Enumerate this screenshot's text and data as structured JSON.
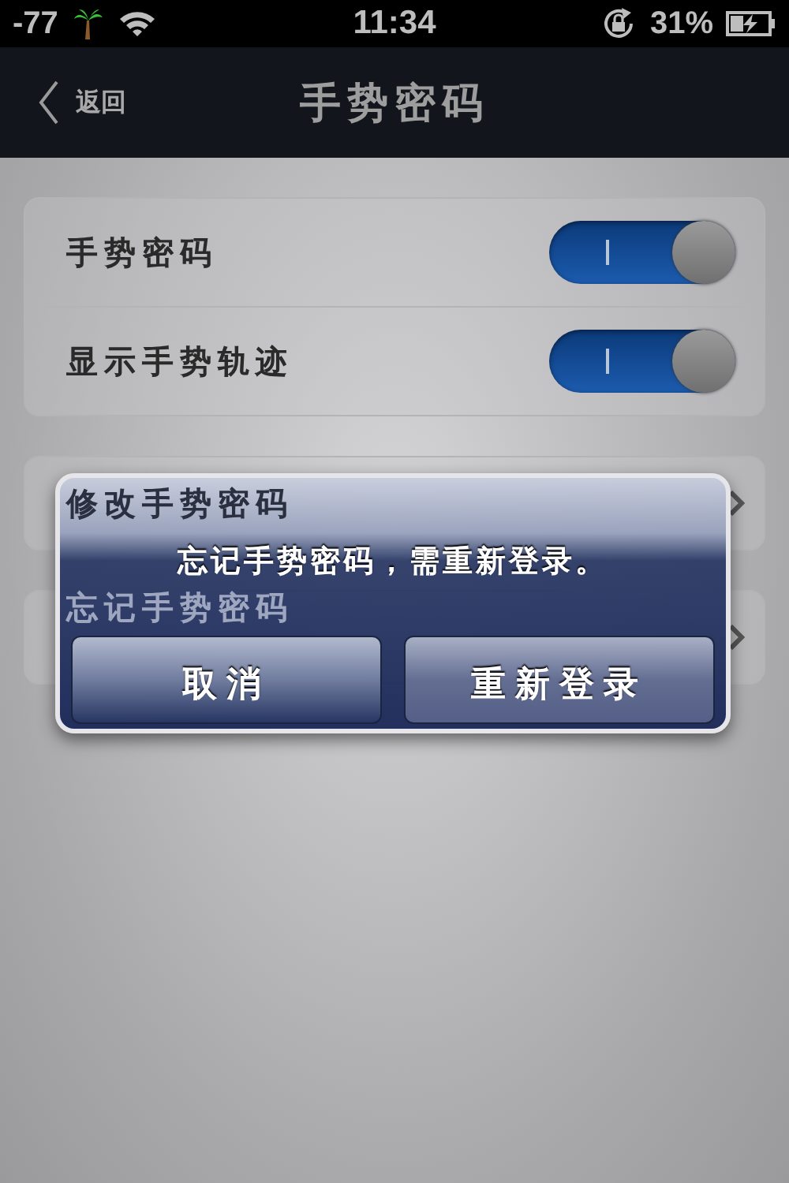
{
  "status_bar": {
    "signal": "-77",
    "time": "11:34",
    "battery": "31%"
  },
  "nav_bar": {
    "back": "返回",
    "title": "手势密码"
  },
  "settings": [
    {
      "label": "手势密码",
      "kind": "toggle",
      "on": true
    },
    {
      "label": "显示手势轨迹",
      "kind": "toggle",
      "on": true
    }
  ],
  "links": [
    {
      "label": "修改手势密码",
      "kind": "link"
    },
    {
      "label": "忘记手势密码",
      "kind": "link"
    }
  ],
  "alert": {
    "message": "忘记手势密码，需重新登录。",
    "buttons": [
      "取消",
      "重新登录"
    ]
  }
}
